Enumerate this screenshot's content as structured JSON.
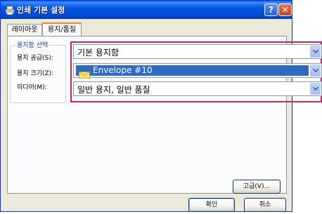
{
  "window": {
    "title": "인쇄 기본 설정",
    "help_glyph": "?",
    "close_glyph": "✕"
  },
  "tabs": [
    {
      "label": "레이아웃"
    },
    {
      "label": "용지/품질"
    }
  ],
  "paper_selection": {
    "legend": "용지함 선택",
    "source": {
      "label": "용지 공급(S):",
      "value": "기본 용지함"
    },
    "size": {
      "label": "용지 크기(Z):",
      "value": "Envelope #10"
    },
    "media": {
      "label": "미디어(M):",
      "value": "일반 용지, 일반 품질"
    }
  },
  "buttons": {
    "advanced": "고급(V)...",
    "ok": "확인",
    "cancel": "취소"
  },
  "colors": {
    "highlight": "#cc2266",
    "selection": "#316ac5",
    "titlebar": "#0054e3"
  }
}
